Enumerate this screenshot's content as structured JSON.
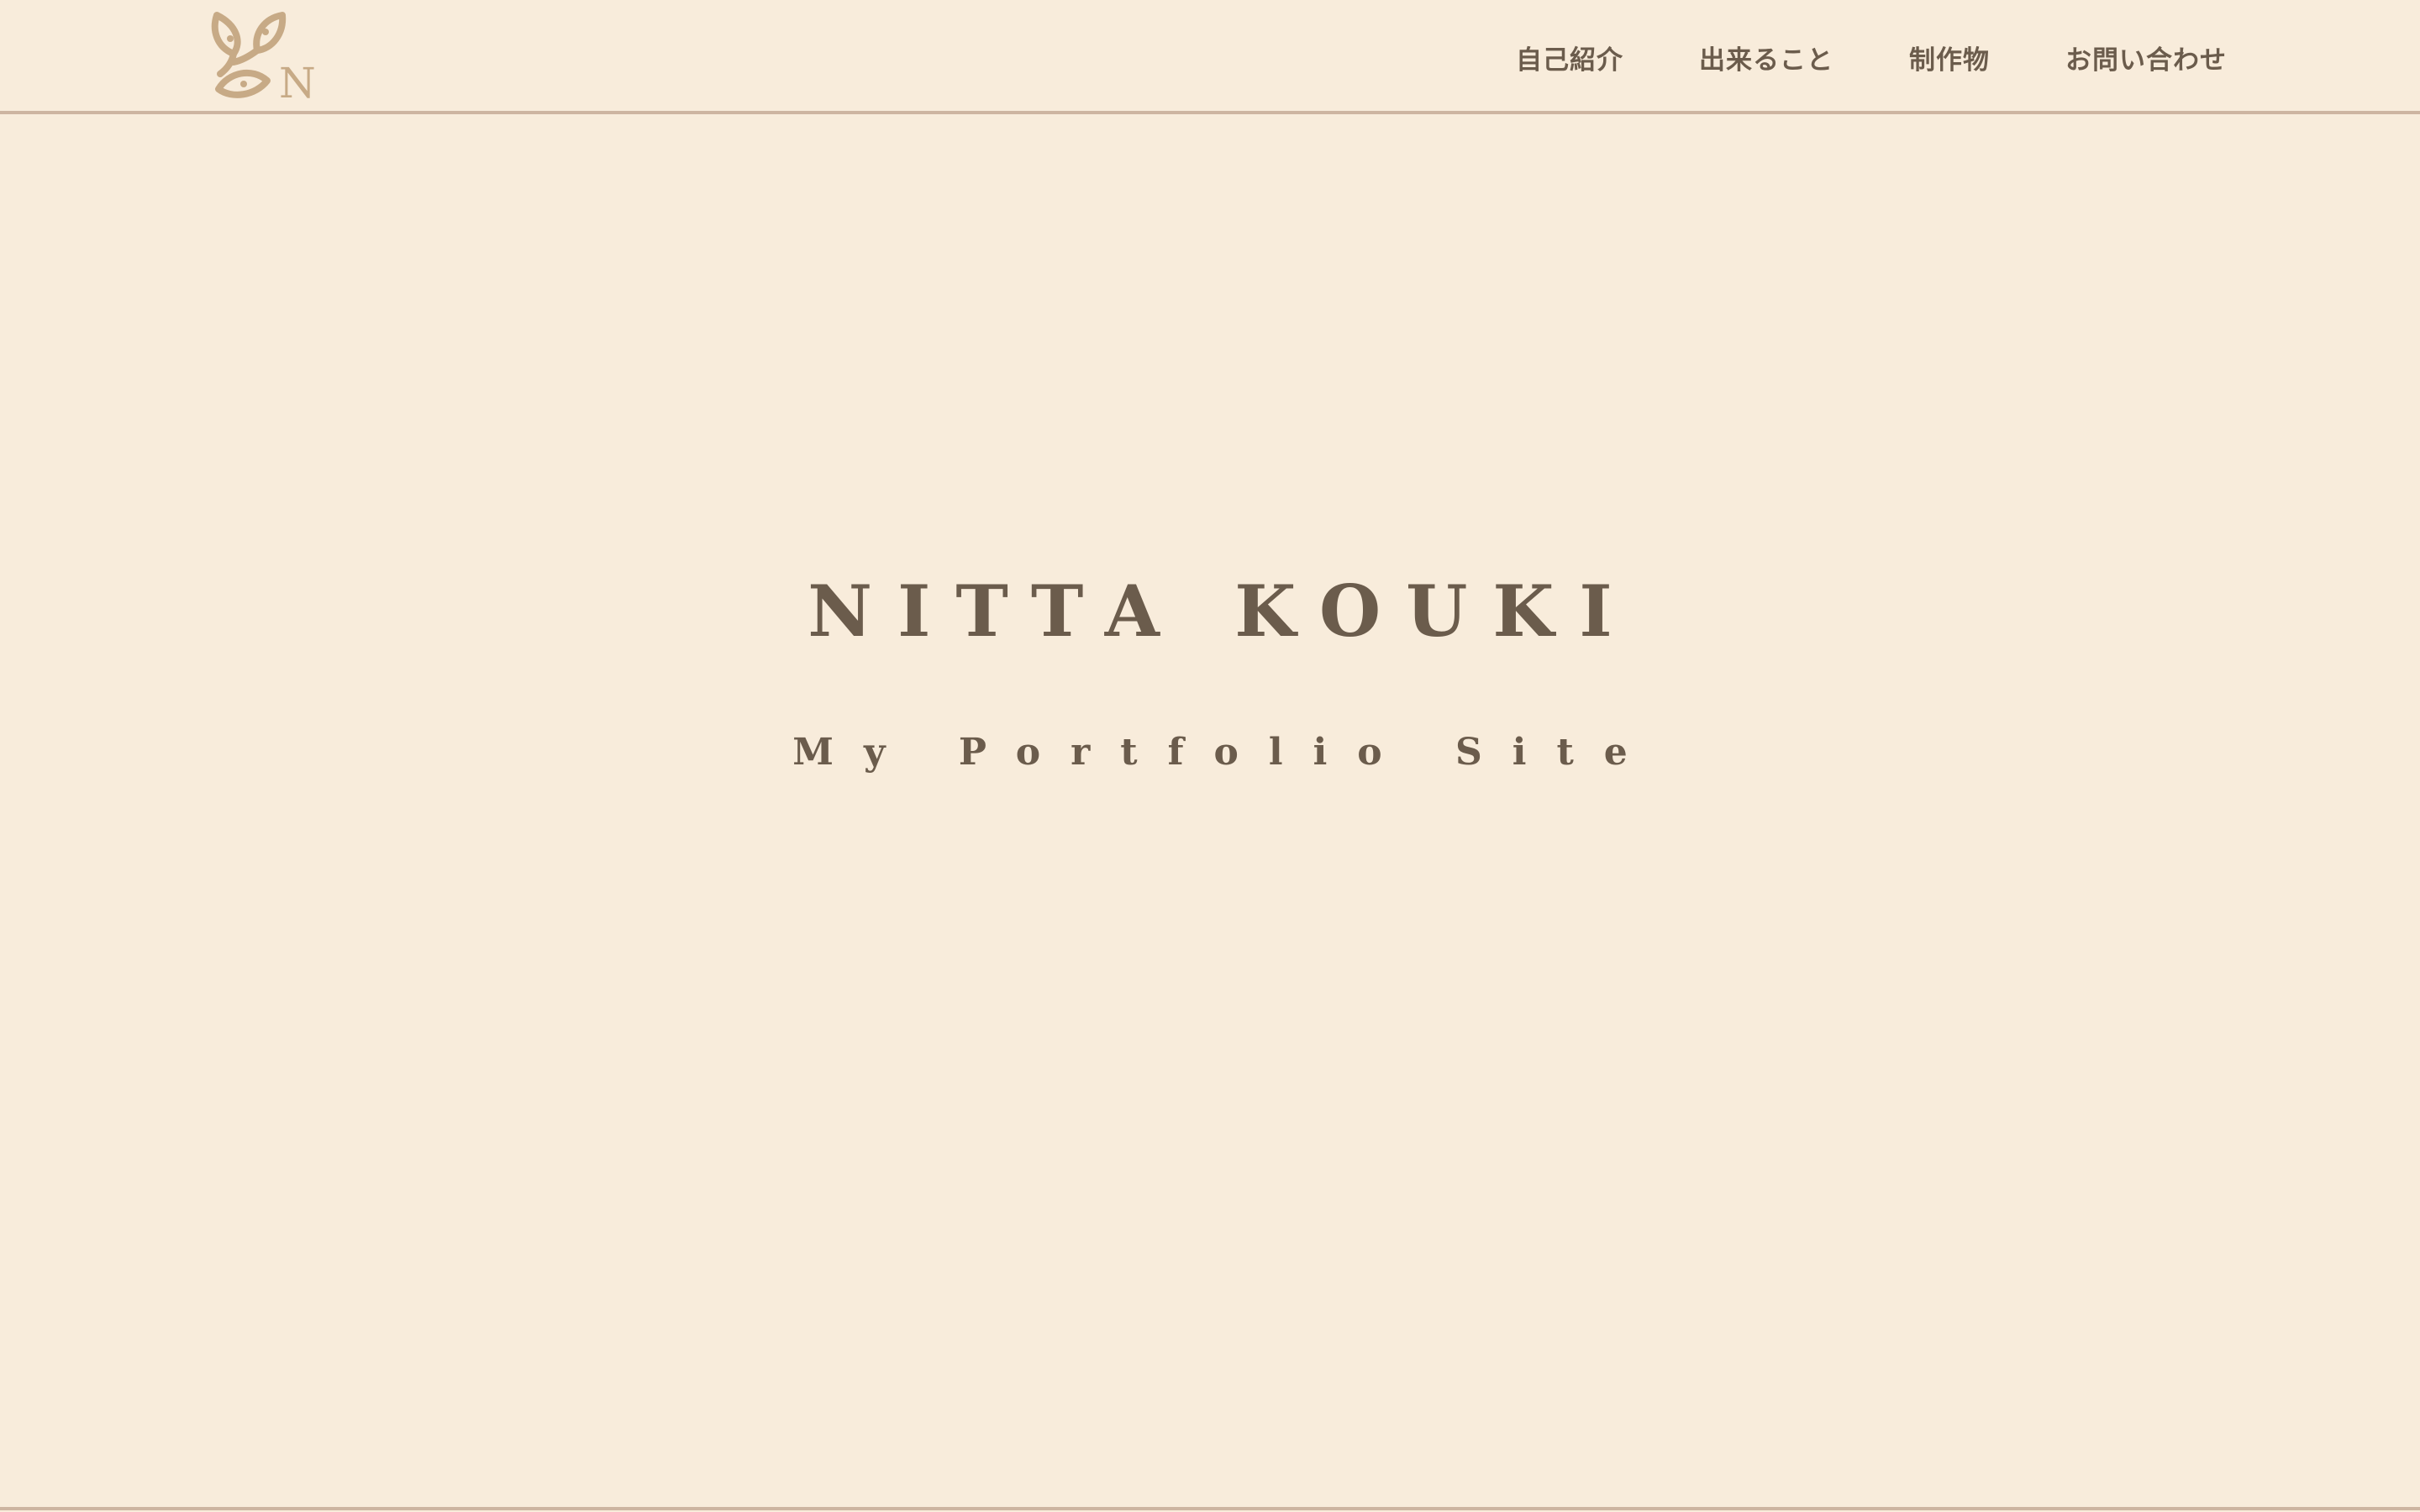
{
  "header": {
    "logo": {
      "icon": "leaf-monogram-icon",
      "letter": "N",
      "color": "#c7aa86"
    },
    "nav": [
      {
        "label": "自己紹介"
      },
      {
        "label": "出来ること"
      },
      {
        "label": "制作物"
      },
      {
        "label": "お問い合わせ"
      }
    ]
  },
  "hero": {
    "title": "NITTA KOUKI",
    "subtitle": "My Portfolio Site"
  },
  "colors": {
    "background": "#f8ecdb",
    "text": "#6b5c4c",
    "rule": "#cdb5a1",
    "logo": "#c7aa86"
  }
}
